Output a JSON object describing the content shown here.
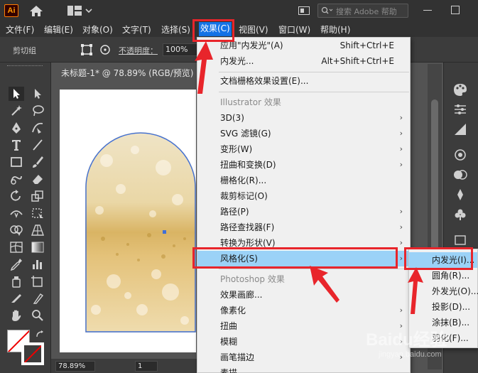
{
  "app": {
    "logo_text": "Ai"
  },
  "titlebar": {
    "search_placeholder": "搜索 Adobe 帮助"
  },
  "menubar": {
    "items": [
      "文件(F)",
      "编辑(E)",
      "对象(O)",
      "文字(T)",
      "选择(S)",
      "效果(C)",
      "视图(V)",
      "窗口(W)",
      "帮助(H)"
    ]
  },
  "controlbar": {
    "group_label": "剪切组",
    "opacity_label": "不透明度：",
    "opacity_value": "100%"
  },
  "document": {
    "tab_title": "未标题-1* @ 78.89% (RGB/预览)"
  },
  "statusbar": {
    "zoom": "78.89%",
    "page": "1"
  },
  "effect_menu": {
    "items": [
      {
        "label": "应用\"内发光\"(A)",
        "shortcut": "Shift+Ctrl+E"
      },
      {
        "label": "内发光...",
        "shortcut": "Alt+Shift+Ctrl+E"
      },
      {
        "label": "文档栅格效果设置(E)..."
      },
      {
        "label": "Illustrator 效果"
      },
      {
        "label": "3D(3)"
      },
      {
        "label": "SVG 滤镜(G)"
      },
      {
        "label": "变形(W)"
      },
      {
        "label": "扭曲和变换(D)"
      },
      {
        "label": "栅格化(R)..."
      },
      {
        "label": "裁剪标记(O)"
      },
      {
        "label": "路径(P)"
      },
      {
        "label": "路径查找器(F)"
      },
      {
        "label": "转换为形状(V)"
      },
      {
        "label": "风格化(S)"
      },
      {
        "label": "Photoshop 效果"
      },
      {
        "label": "效果画廊..."
      },
      {
        "label": "像素化"
      },
      {
        "label": "扭曲"
      },
      {
        "label": "模糊"
      },
      {
        "label": "画笔描边"
      },
      {
        "label": "素描"
      }
    ]
  },
  "stylize_submenu": {
    "items": [
      "内发光(I)...",
      "圆角(R)...",
      "外发光(O)...",
      "投影(D)...",
      "涂抹(B)...",
      "羽化(F)..."
    ]
  },
  "watermark": {
    "text": "Baidu经验",
    "subtext": "jingyan.baidu.com"
  },
  "colors": {
    "highlight": "#9bd2f7",
    "annotation_red": "#e8252b",
    "panel_dark": "#323232",
    "panel_mid": "#3c3c3c",
    "ai_orange": "#ff9a00"
  }
}
